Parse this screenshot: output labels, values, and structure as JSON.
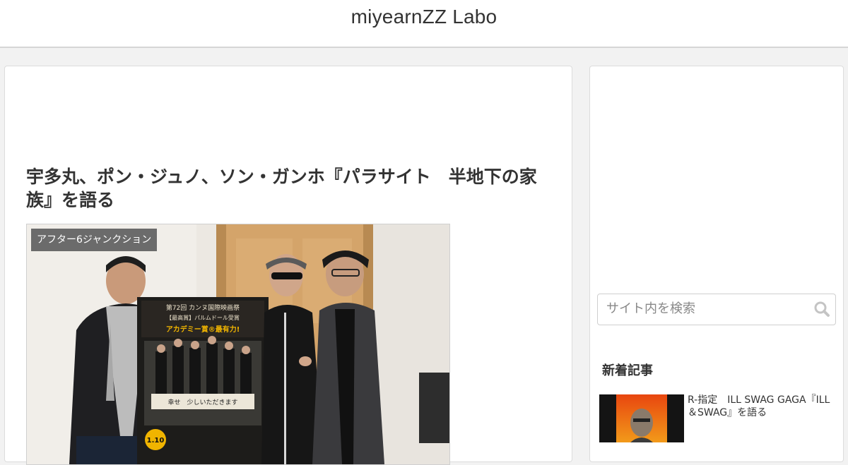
{
  "site": {
    "title": "miyearnZZ Labo"
  },
  "article": {
    "title": "宇多丸、ポン・ジュノ、ソン・ガンホ『パラサイト　半地下の家族』を語る",
    "category": "アフター6ジャンクション",
    "poster": {
      "line1": "第72回 カンヌ国際映画祭",
      "line2": "【最高賞】パルムドール受賞",
      "line3": "アカデミー賞®最有力!",
      "tagline": "幸せ　少しいただきます",
      "date": "1.10"
    }
  },
  "sidebar": {
    "search": {
      "placeholder": "サイト内を検索"
    },
    "new_entries": {
      "heading": "新着記事",
      "items": [
        {
          "title": "R-指定　ILL SWAG GAGA『ILL＆SWAG』を語る"
        }
      ]
    }
  },
  "colors": {
    "category_bg": "#6b6b6b",
    "poster_accent": "#f0b400"
  }
}
